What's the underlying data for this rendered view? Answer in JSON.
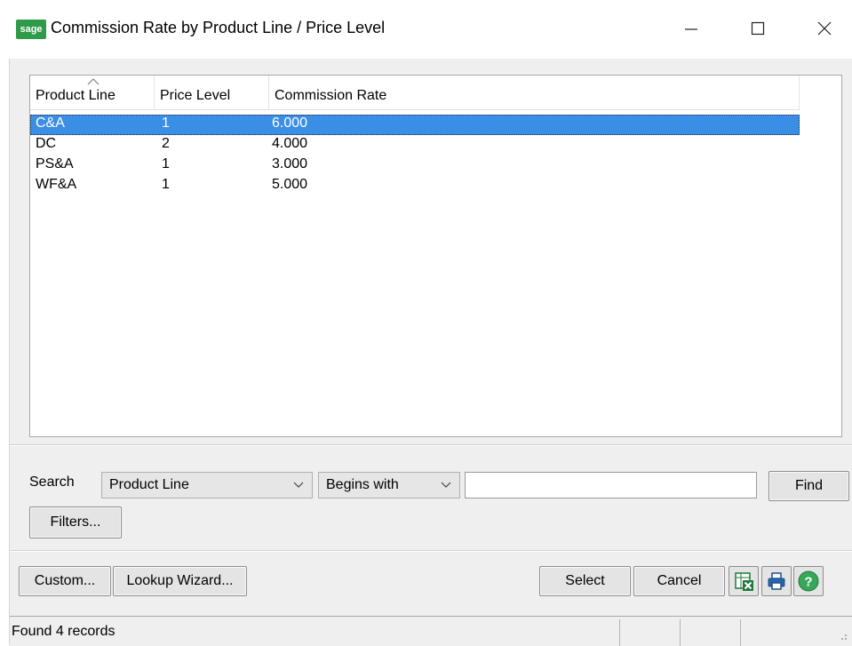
{
  "window": {
    "app_logo_text": "sage",
    "title": "Commission Rate by Product Line / Price Level"
  },
  "list": {
    "columns": [
      "Product Line",
      "Price Level",
      "Commission Rate"
    ],
    "rows": [
      {
        "product_line": "C&A",
        "price_level": "1",
        "commission_rate": "6.000",
        "selected": true
      },
      {
        "product_line": "DC",
        "price_level": "2",
        "commission_rate": "4.000",
        "selected": false
      },
      {
        "product_line": "PS&A",
        "price_level": "1",
        "commission_rate": "3.000",
        "selected": false
      },
      {
        "product_line": "WF&A",
        "price_level": "1",
        "commission_rate": "5.000",
        "selected": false
      }
    ],
    "selection_color": "#3b8ee6"
  },
  "search": {
    "label": "Search",
    "field_value": "Product Line",
    "operator_value": "Begins with",
    "text_value": "",
    "find_label": "Find",
    "filters_label": "Filters..."
  },
  "buttons": {
    "custom_label": "Custom...",
    "lookup_wizard_label": "Lookup Wizard...",
    "select_label": "Select",
    "cancel_label": "Cancel",
    "excel_icon": "excel-export-icon",
    "print_icon": "printer-icon",
    "help_icon": "help-icon"
  },
  "status": {
    "text": "Found 4 records"
  }
}
